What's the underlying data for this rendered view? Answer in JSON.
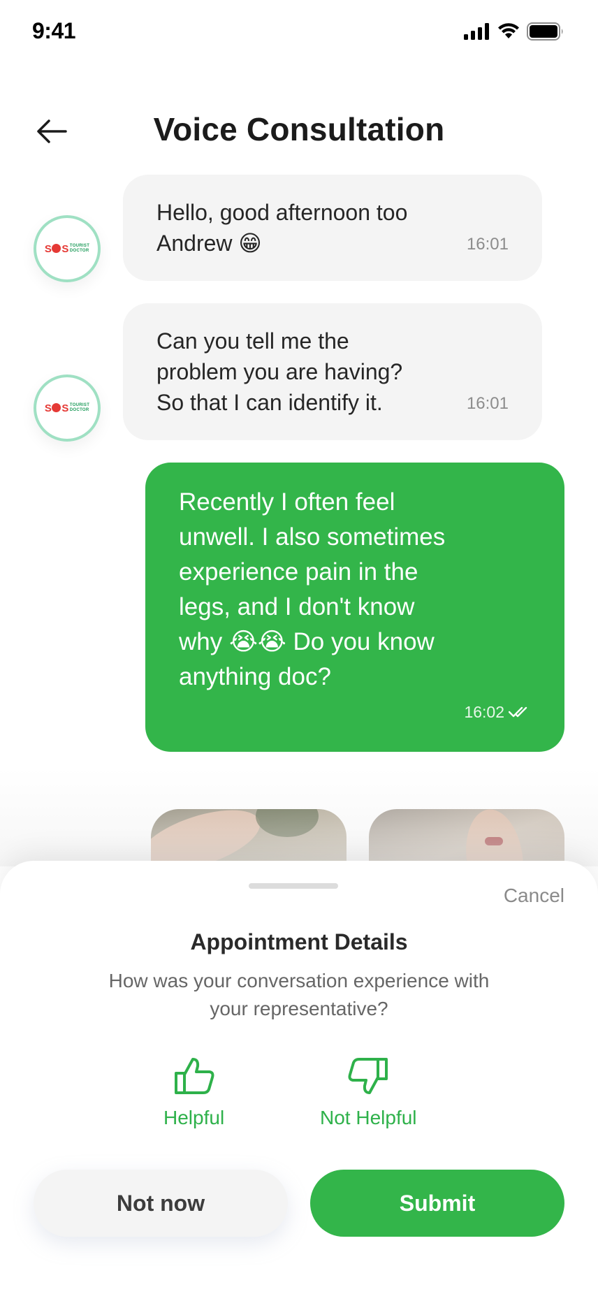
{
  "status_bar": {
    "time": "9:41"
  },
  "header": {
    "title": "Voice Consultation"
  },
  "brand": {
    "logo_text_sos": "SOS",
    "logo_text_line1": "TOURIST",
    "logo_text_line2": "DOCTOR"
  },
  "messages": [
    {
      "from": "doctor",
      "text": "Hello, good afternoon too Andrew 😁",
      "time": "16:01"
    },
    {
      "from": "doctor",
      "text": "Can you tell me the problem you are having? So that I can identify it.",
      "time": "16:01"
    },
    {
      "from": "user",
      "text": "Recently I often feel unwell. I also sometimes experience pain in the legs, and I don't know why 😭😭 Do you know anything doc?",
      "time": "16:02"
    }
  ],
  "sheet": {
    "cancel_label": "Cancel",
    "title": "Appointment Details",
    "subtitle": "How was your conversation experience with your representative?",
    "options": [
      {
        "label": "Helpful",
        "icon": "thumbs-up-icon"
      },
      {
        "label": "Not Helpful",
        "icon": "thumbs-down-icon"
      }
    ],
    "not_now_label": "Not now",
    "submit_label": "Submit"
  },
  "colors": {
    "accent": "#33b54a",
    "bubble_in": "#f4f4f4",
    "avatar_ring": "#9fe0c3"
  }
}
